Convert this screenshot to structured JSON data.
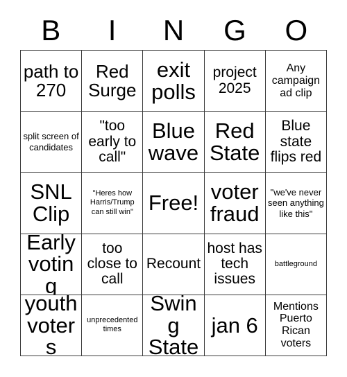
{
  "card": {
    "title": "BINGO",
    "header_letters": [
      "B",
      "I",
      "N",
      "G",
      "O"
    ],
    "columns": 5,
    "rows": 5,
    "colors": {
      "background": "#ffffff",
      "text": "#000000",
      "grid_line": "#3a3a3a"
    },
    "cells": [
      {
        "text": "path to 270",
        "size": "fs-lg"
      },
      {
        "text": "Red Surge",
        "size": "fs-lg"
      },
      {
        "text": "exit polls",
        "size": "fs-xl"
      },
      {
        "text": "project 2025",
        "size": "fs-md"
      },
      {
        "text": "Any campaign ad clip",
        "size": "fs-sm"
      },
      {
        "text": "split screen of candidates",
        "size": "fs-xs"
      },
      {
        "text": "\"too early to call\"",
        "size": "fs-md"
      },
      {
        "text": "Blue wave",
        "size": "fs-xl"
      },
      {
        "text": "Red State",
        "size": "fs-xl"
      },
      {
        "text": "Blue state flips red",
        "size": "fs-md"
      },
      {
        "text": "SNL Clip",
        "size": "fs-xl"
      },
      {
        "text": "\"Heres how Harris/Trump can still win\"",
        "size": "fs-xxs"
      },
      {
        "text": "Free!",
        "size": "fs-xl"
      },
      {
        "text": "voter fraud",
        "size": "fs-xl"
      },
      {
        "text": "\"we've never seen anything like this\"",
        "size": "fs-xs"
      },
      {
        "text": "Early voting",
        "size": "fs-xl"
      },
      {
        "text": "too close to call",
        "size": "fs-md"
      },
      {
        "text": "Recount",
        "size": "fs-md"
      },
      {
        "text": "host has tech issues",
        "size": "fs-md"
      },
      {
        "text": "battleground",
        "size": "fs-xxs"
      },
      {
        "text": "youth voters",
        "size": "fs-xl"
      },
      {
        "text": "unprecedented times",
        "size": "fs-xxs"
      },
      {
        "text": "Swing State",
        "size": "fs-xl"
      },
      {
        "text": "jan 6",
        "size": "fs-xl"
      },
      {
        "text": "Mentions Puerto Rican voters",
        "size": "fs-sm"
      }
    ]
  }
}
